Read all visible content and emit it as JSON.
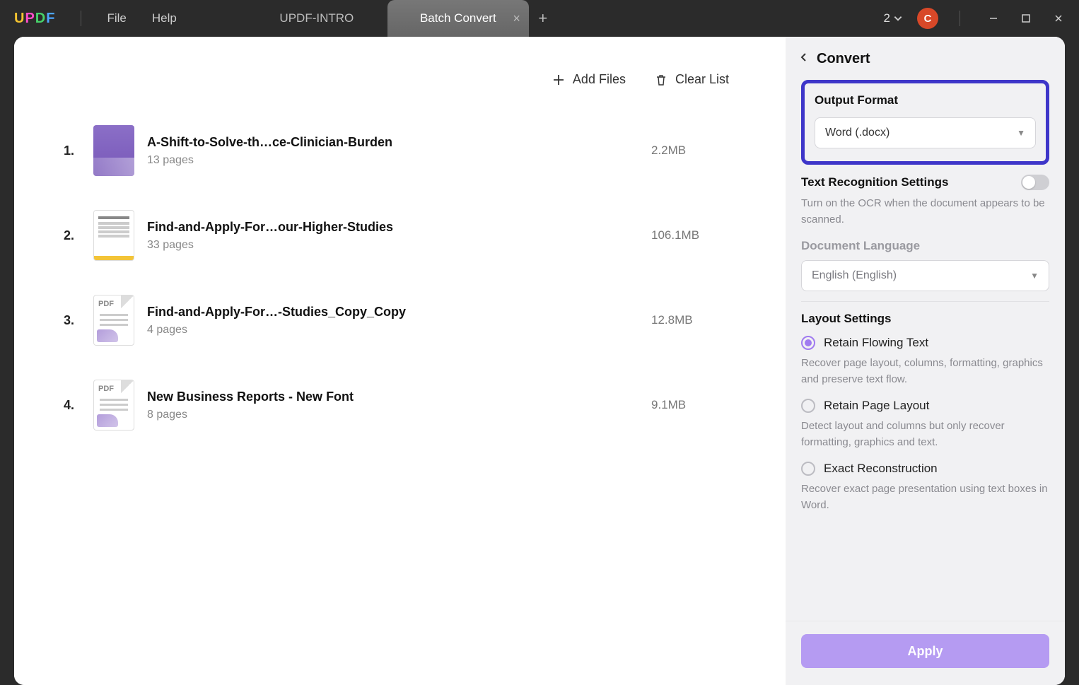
{
  "app": {
    "logo_letters": [
      "U",
      "P",
      "D",
      "F"
    ],
    "menu": {
      "file": "File",
      "help": "Help"
    },
    "tabs": [
      {
        "label": "UPDF-INTRO",
        "active": false
      },
      {
        "label": "Batch Convert",
        "active": true
      }
    ],
    "doc_count": "2",
    "avatar_initial": "C"
  },
  "toolbar": {
    "add_files": "Add Files",
    "clear_list": "Clear List"
  },
  "files": [
    {
      "idx": "1.",
      "name": "A-Shift-to-Solve-th…ce-Clinician-Burden",
      "pages": "13 pages",
      "size": "2.2MB",
      "thumb": "purple"
    },
    {
      "idx": "2.",
      "name": "Find-and-Apply-For…our-Higher-Studies",
      "pages": "33 pages",
      "size": "106.1MB",
      "thumb": "doc"
    },
    {
      "idx": "3.",
      "name": "Find-and-Apply-For…-Studies_Copy_Copy",
      "pages": "4 pages",
      "size": "12.8MB",
      "thumb": "pdf"
    },
    {
      "idx": "4.",
      "name": "New Business Reports - New Font",
      "pages": "8 pages",
      "size": "9.1MB",
      "thumb": "pdf"
    }
  ],
  "panel": {
    "title": "Convert",
    "output_format": {
      "label": "Output Format",
      "value": "Word (.docx)"
    },
    "ocr": {
      "label": "Text Recognition Settings",
      "hint": "Turn on the OCR when the document appears to be scanned.",
      "enabled": false
    },
    "language": {
      "label": "Document Language",
      "value": "English (English)"
    },
    "layout": {
      "label": "Layout Settings",
      "options": [
        {
          "id": "flow",
          "label": "Retain Flowing Text",
          "hint": "Recover page layout, columns, formatting, graphics and preserve text flow.",
          "selected": true
        },
        {
          "id": "page",
          "label": "Retain Page Layout",
          "hint": "Detect layout and columns but only recover formatting, graphics and text.",
          "selected": false
        },
        {
          "id": "exact",
          "label": "Exact Reconstruction",
          "hint": "Recover exact page presentation using text boxes in Word.",
          "selected": false
        }
      ]
    },
    "apply": "Apply"
  },
  "misc": {
    "pdf_label": "PDF"
  }
}
